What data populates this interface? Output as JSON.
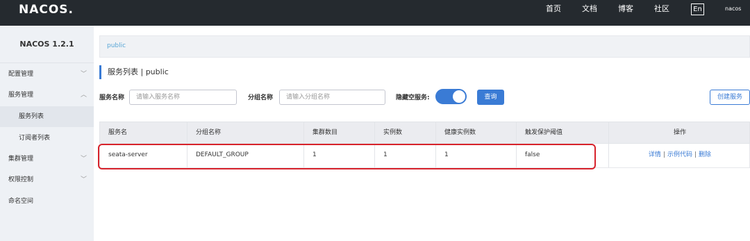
{
  "header": {
    "logo": "NACOS.",
    "nav": [
      "首页",
      "文档",
      "博客",
      "社区"
    ],
    "lang": "En",
    "user": "nacos"
  },
  "sidebar": {
    "version": "NACOS 1.2.1",
    "items": [
      {
        "label": "配置管理",
        "chevron": "﹀"
      },
      {
        "label": "服务管理",
        "chevron": "︿"
      },
      {
        "label": "服务列表",
        "chevron": ""
      },
      {
        "label": "订阅者列表",
        "chevron": ""
      },
      {
        "label": "集群管理",
        "chevron": "﹀"
      },
      {
        "label": "权限控制",
        "chevron": "﹀"
      },
      {
        "label": "命名空间",
        "chevron": ""
      }
    ]
  },
  "main": {
    "namespace": "public",
    "title": "服务列表 | public",
    "filters": {
      "service_name_label": "服务名称",
      "service_name_placeholder": "请输入服务名称",
      "group_name_label": "分组名称",
      "group_name_placeholder": "请输入分组名称",
      "hide_empty_label": "隐藏空服务:",
      "hide_empty_on": true,
      "query_button": "查询",
      "create_button": "创建服务"
    },
    "table": {
      "columns": [
        "服务名",
        "分组名称",
        "集群数目",
        "实例数",
        "健康实例数",
        "触发保护阈值",
        "操作"
      ],
      "rows": [
        {
          "service": "seata-server",
          "group": "DEFAULT_GROUP",
          "clusters": "1",
          "instances": "1",
          "healthy": "1",
          "threshold": "false",
          "actions": [
            "详情",
            "示例代码",
            "删除"
          ]
        }
      ]
    }
  },
  "colors": {
    "accent": "#3a7bd5",
    "topbar": "#252a2f",
    "highlight": "#d7222b"
  }
}
